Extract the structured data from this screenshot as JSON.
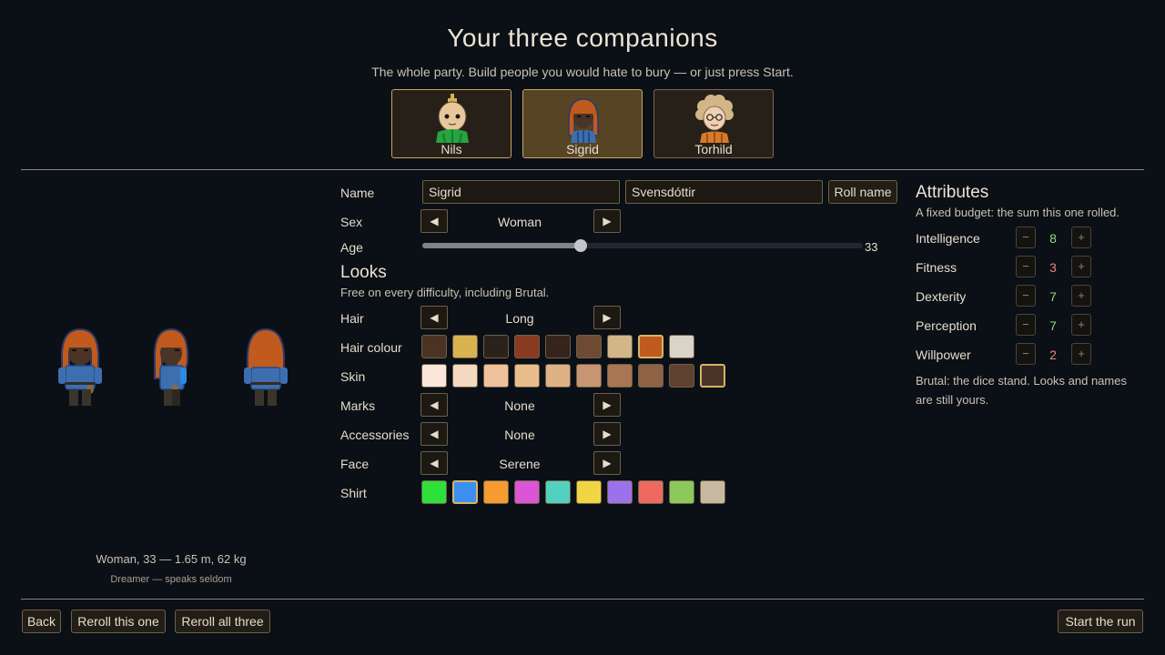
{
  "screen": {
    "title": "Your three companions",
    "subtitle": "The whole party. Build people you would hate to bury — or just press Start."
  },
  "companions": [
    {
      "name": "Nils"
    },
    {
      "name": "Sigrid"
    },
    {
      "name": "Torhild"
    }
  ],
  "form": {
    "name_label": "Name",
    "first_name": "Sigrid",
    "last_name": "Svensdóttir",
    "roll_name": "Roll name",
    "sex_label": "Sex",
    "sex_value": "Woman",
    "age_label": "Age",
    "age_value": "33",
    "age_fraction": 0.36,
    "prev_arrow": "◀",
    "next_arrow": "▶"
  },
  "looks": {
    "heading": "Looks",
    "subtitle": "Free on every difficulty, including Brutal.",
    "hair_label": "Hair",
    "hair_value": "Long",
    "hair_colour_label": "Hair colour",
    "hair_colours": [
      "#4a3322",
      "#d9b251",
      "#2b221c",
      "#8a3a22",
      "#35241a",
      "#6e4a33",
      "#d2b688",
      "#c05a1f",
      "#d9d4c8"
    ],
    "hair_colour_selected": 7,
    "skin_label": "Skin",
    "skin_colours": [
      "#fbe6dc",
      "#f4d8c2",
      "#eec39c",
      "#e9bd8c",
      "#ddb184",
      "#c79571",
      "#a87653",
      "#8e6244",
      "#5f4130",
      "#4a3427"
    ],
    "skin_selected": 9,
    "marks_label": "Marks",
    "marks_value": "None",
    "accessories_label": "Accessories",
    "accessories_value": "None",
    "face_label": "Face",
    "face_value": "Serene",
    "shirt_label": "Shirt",
    "shirt_colours": [
      "#2ee03a",
      "#3d8fef",
      "#f69a32",
      "#db55d6",
      "#52d1c0",
      "#f2d543",
      "#9c72ec",
      "#ee6a61",
      "#8dc95a",
      "#c6b9a0"
    ],
    "shirt_selected": 1
  },
  "attributes": {
    "heading": "Attributes",
    "subtitle": "A fixed budget: the sum this one rolled.",
    "minus": "−",
    "plus": "+",
    "items": [
      {
        "label": "Intelligence",
        "value": "8",
        "color": "#8fd67a"
      },
      {
        "label": "Fitness",
        "value": "3",
        "color": "#e8867a"
      },
      {
        "label": "Dexterity",
        "value": "7",
        "color": "#8fd67a"
      },
      {
        "label": "Perception",
        "value": "7",
        "color": "#8fd67a"
      },
      {
        "label": "Willpower",
        "value": "2",
        "color": "#e8867a"
      }
    ],
    "note": "Brutal: the dice stand. Looks and names are still yours."
  },
  "preview": {
    "description": "Woman, 33 — 1.65 m, 62 kg",
    "trait": "Dreamer — speaks seldom"
  },
  "footer": {
    "back": "Back",
    "reroll_one": "Reroll this one",
    "reroll_all": "Reroll all three",
    "start": "Start the run"
  }
}
